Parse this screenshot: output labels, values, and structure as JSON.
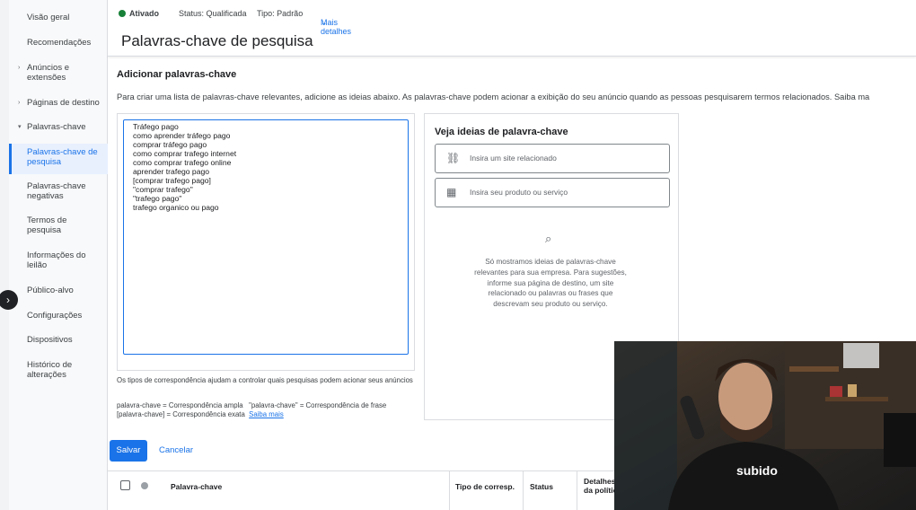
{
  "status": {
    "state": "Ativado",
    "status": "Status: Qualificada",
    "type": "Tipo: Padrão",
    "more": "Mais detalhes"
  },
  "sidebar": {
    "items": [
      {
        "label": "Visão geral"
      },
      {
        "label": "Recomendações"
      },
      {
        "label": "Anúncios e\nextensões"
      },
      {
        "label": "Páginas de destino"
      },
      {
        "label": "Palavras-chave"
      },
      {
        "label": "Palavras-chave de\npesquisa"
      },
      {
        "label": "Palavras-chave\nnegativas"
      },
      {
        "label": "Termos de\npesquisa"
      },
      {
        "label": "Informações do\nleilão"
      },
      {
        "label": "Público-alvo"
      },
      {
        "label": "Configurações"
      },
      {
        "label": "Dispositivos"
      },
      {
        "label": "Histórico de\nalterações"
      }
    ]
  },
  "page": {
    "title": "Palavras-chave de pesquisa",
    "section_title": "Adicionar palavras-chave",
    "intro": "Para criar uma lista de palavras-chave relevantes, adicione as ideias abaixo. As palavras-chave podem acionar a exibição do seu anúncio quando as pessoas pesquisarem termos relacionados. Saiba ma"
  },
  "keywords_text": "Tráfego pago\ncomo aprender tráfego pago\ncomprar tráfego pago\ncomo comprar trafego internet\ncomo comprar trafego online\naprender trafego pago\n[comprar trafego pago]\n\"comprar trafego\"\n\"trafego pago\"\ntrafego organico ou pago",
  "match_help": "Os tipos de correspondência ajudam a controlar quais pesquisas podem acionar seus anúncios",
  "match_legend_line1": "palavra-chave = Correspondência ampla   \"palavra-chave\" = Correspondência de frase",
  "match_legend_line2": "[palavra-chave] = Correspondência exata",
  "learn_more": "Saiba mais",
  "ideas": {
    "title": "Veja ideias de palavra-chave",
    "site_placeholder": "Insira um site relacionado",
    "product_placeholder": "Insira seu produto ou serviço",
    "empty_text": "Só mostramos ideias de palavras-chave relevantes para sua empresa. Para sugestões, informe sua página de destino, um site relacionado ou palavras ou frases que descrevam seu produto ou serviço."
  },
  "actions": {
    "save": "Salvar",
    "cancel": "Cancelar"
  },
  "table": {
    "headers": {
      "keyword": "Palavra-chave",
      "match_type": "Tipo de corresp.",
      "status": "Status",
      "policy": "Detalhes da política"
    }
  },
  "webcam": {
    "shirt_text": "subido"
  },
  "colors": {
    "accent": "#1a73e8",
    "active_status": "#188038"
  }
}
